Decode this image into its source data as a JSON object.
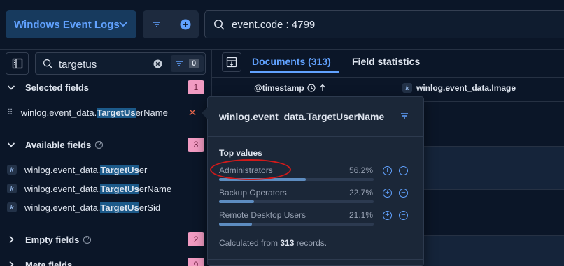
{
  "header": {
    "dataview_label": "Windows Event Logs",
    "query": "event.code : 4799"
  },
  "sidebar": {
    "search_value": "targetus",
    "filter_count": "0",
    "sections": {
      "selected": {
        "label": "Selected fields",
        "count": "1"
      },
      "available": {
        "label": "Available fields",
        "count": "3"
      },
      "empty": {
        "label": "Empty fields",
        "count": "2"
      },
      "meta": {
        "label": "Meta fields",
        "count": "9"
      }
    },
    "selected_fields": [
      {
        "pre": "winlog.event_data.",
        "match": "TargetUs",
        "post": "erName"
      }
    ],
    "available_fields": [
      {
        "type": "k",
        "pre": "winlog.event_data.",
        "match": "TargetUs",
        "post": "er"
      },
      {
        "type": "k",
        "pre": "winlog.event_data.",
        "match": "TargetUs",
        "post": "erName"
      },
      {
        "type": "k",
        "pre": "winlog.event_data.",
        "match": "TargetUs",
        "post": "erSid"
      }
    ]
  },
  "main": {
    "tabs": {
      "documents": "Documents (313)",
      "field_statistics": "Field statistics"
    },
    "columns": {
      "timestamp": "@timestamp",
      "image": "winlog.event_data.Image",
      "image_type": "k"
    }
  },
  "popover": {
    "title": "winlog.event_data.TargetUserName",
    "subtitle": "Top values",
    "top_values": [
      {
        "label": "Administrators",
        "percent": "56.2%",
        "fraction": 0.562
      },
      {
        "label": "Backup Operators",
        "percent": "22.7%",
        "fraction": 0.227
      },
      {
        "label": "Remote Desktop Users",
        "percent": "21.1%",
        "fraction": 0.211
      }
    ],
    "footer_prefix": "Calculated from ",
    "footer_count": "313",
    "footer_suffix": " records."
  },
  "colors": {
    "accent": "#61a2ff",
    "badge": "#f19bc2",
    "annotation": "#d11a1a"
  }
}
